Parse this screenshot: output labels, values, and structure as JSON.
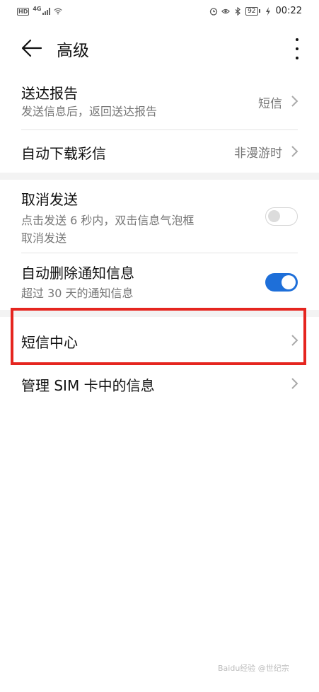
{
  "status_bar": {
    "hd": "HD",
    "network": "4G",
    "battery": "92",
    "time": "00:22"
  },
  "header": {
    "title": "高级"
  },
  "settings": {
    "delivery_report": {
      "title": "送达报告",
      "subtitle": "发送信息后，返回送达报告",
      "value": "短信"
    },
    "auto_download_mms": {
      "title": "自动下载彩信",
      "value": "非漫游时"
    },
    "cancel_send": {
      "title": "取消发送",
      "subtitle_line1": "点击发送 6 秒内，双击信息气泡框",
      "subtitle_line2": "取消发送",
      "enabled": false
    },
    "auto_delete_notifications": {
      "title": "自动删除通知信息",
      "subtitle": "超过 30 天的通知信息",
      "enabled": true
    },
    "sms_center": {
      "title": "短信中心"
    },
    "manage_sim_messages": {
      "title": "管理 SIM 卡中的信息"
    }
  },
  "colors": {
    "accent": "#1e6fd9",
    "highlight_box": "#e5251f"
  },
  "watermark": "Baidu经验 @世纪宗"
}
